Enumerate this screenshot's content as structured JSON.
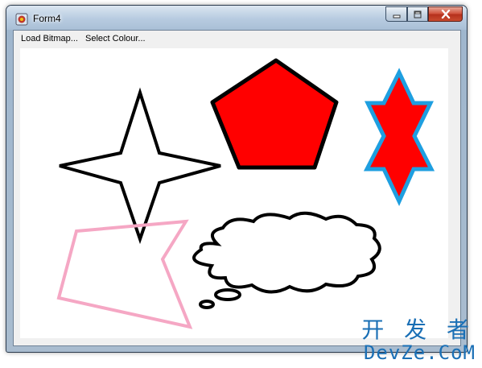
{
  "window": {
    "title": "Form4",
    "icon": "app-icon"
  },
  "caption": {
    "minimize_icon": "minimize-icon",
    "maximize_icon": "maximize-icon",
    "close_icon": "close-icon"
  },
  "menu": {
    "items": [
      {
        "label": "Load Bitmap..."
      },
      {
        "label": "Select Colour..."
      }
    ]
  },
  "shapes": {
    "colors": {
      "outline": "#000000",
      "fill_red": "#ff0000",
      "star_outline_blue": "#1e9fe0",
      "pink_outline": "#f5a7c4"
    },
    "items": [
      "four-point-star",
      "pentagon",
      "six-point-star",
      "pink-polygon",
      "thought-cloud"
    ]
  },
  "watermark": {
    "line1": "开 发 者",
    "line2": "DevZe.CoM",
    "color": "#1a6fb5"
  }
}
